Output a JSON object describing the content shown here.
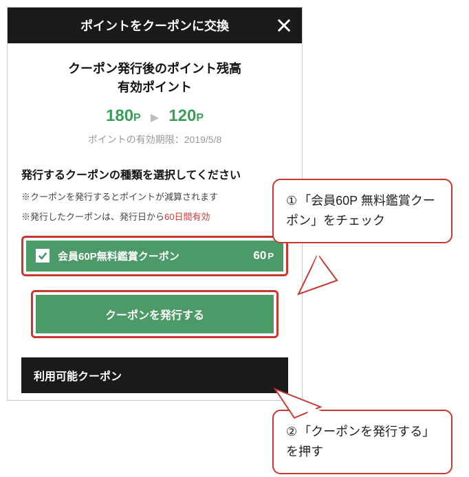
{
  "titlebar": {
    "title": "ポイントをクーポンに交換"
  },
  "balance": {
    "heading_line1": "クーポン発行後のポイント残高",
    "heading_line2": "有効ポイント",
    "before_value": "180",
    "before_unit": "P",
    "after_value": "120",
    "after_unit": "P",
    "expiry_label": "ポイントの有効期限：",
    "expiry_date": "2019/5/8"
  },
  "select": {
    "heading": "発行するクーポンの種類を選択してください",
    "note1_prefix": "※クーポンを発行するとポイントが減算されます",
    "note2_prefix": "※発行したクーポンは、発行日から",
    "note2_valid": "60日間有効"
  },
  "coupon": {
    "label": "会員60P無料鑑賞クーポン",
    "cost_value": "60",
    "cost_unit": "P"
  },
  "issue_button": {
    "label": "クーポンを発行する"
  },
  "available_section": {
    "header": "利用可能クーポン"
  },
  "callouts": {
    "c1_num": "①",
    "c1_text": "「会員60P 無料鑑賞クーポン」をチェック",
    "c2_num": "②",
    "c2_text": "「クーポンを発行する」を押す"
  }
}
